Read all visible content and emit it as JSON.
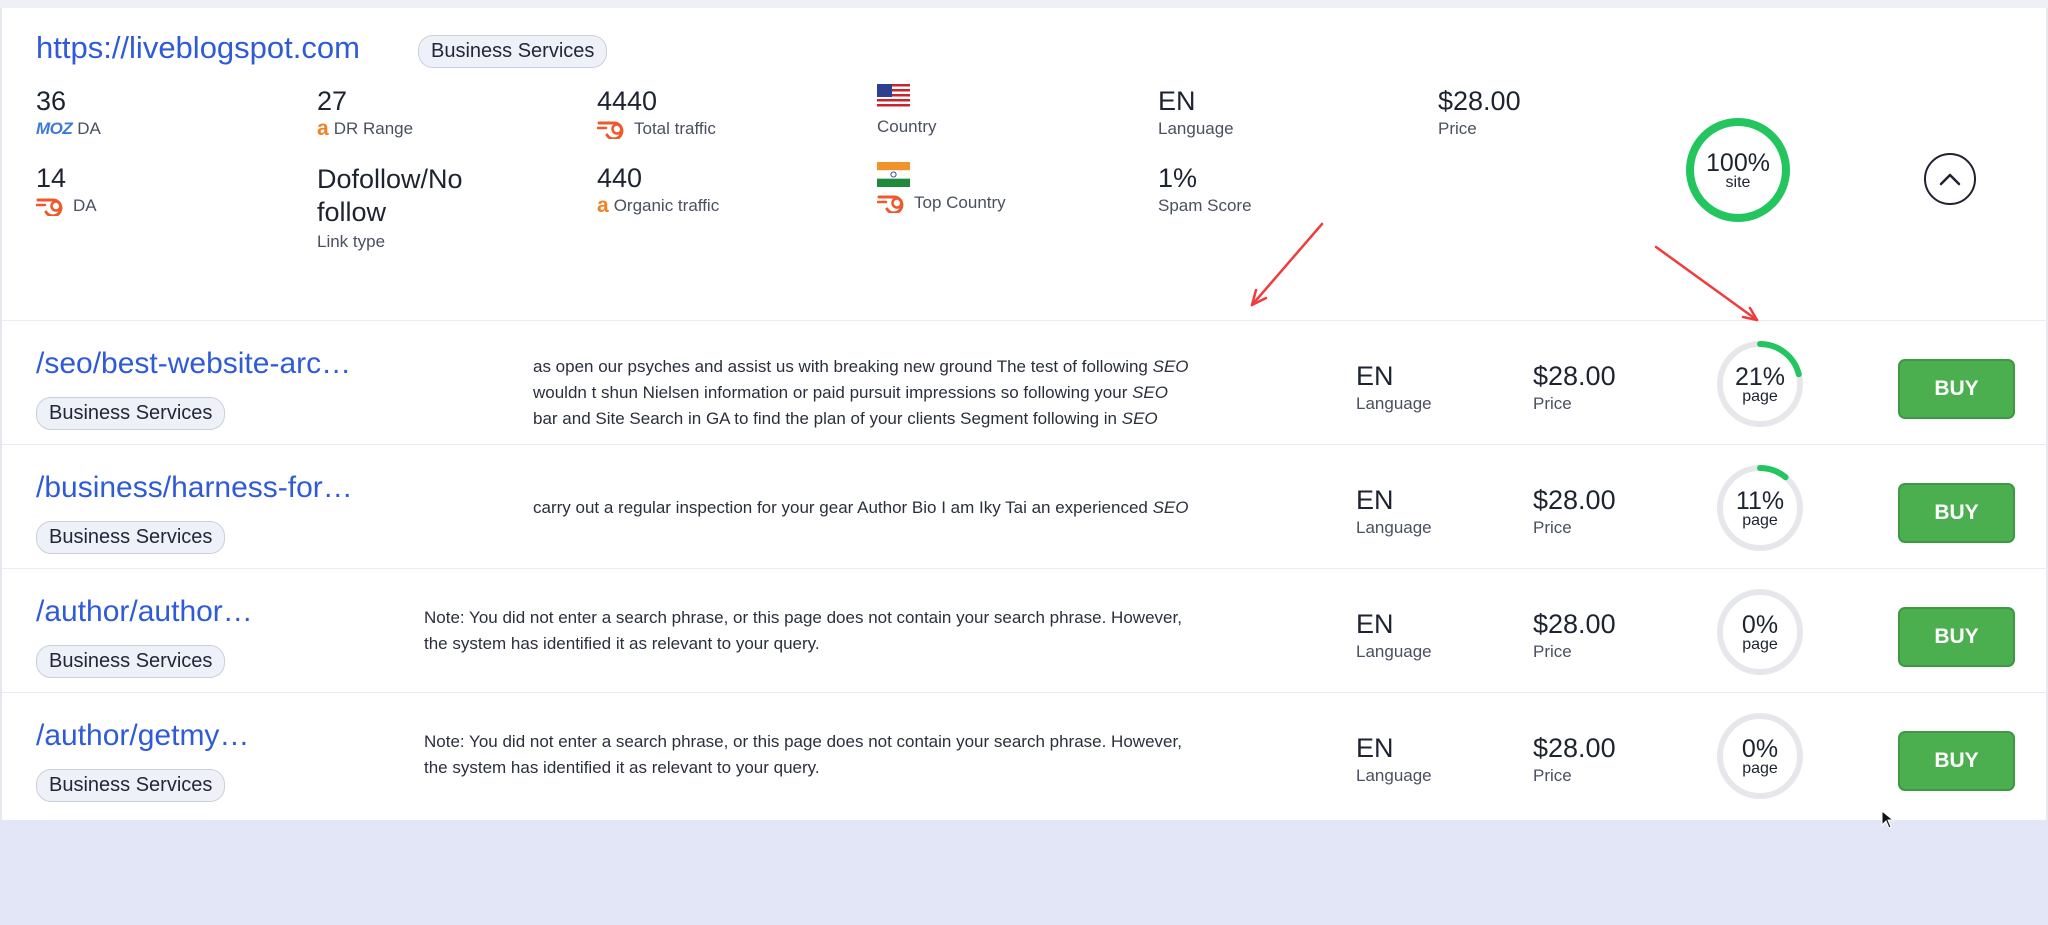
{
  "site": {
    "url": "https://liveblogspot.com",
    "category": "Business Services",
    "metrics": {
      "moz_da": {
        "value": "36",
        "brand": "MOZ",
        "label": "DA"
      },
      "dr": {
        "value": "27",
        "brand": "a",
        "label": "DR Range"
      },
      "total_traffic": {
        "value": "4440",
        "label": "Total traffic"
      },
      "country": {
        "label": "Country",
        "flag": "us-flag-icon"
      },
      "language": {
        "value": "EN",
        "label": "Language"
      },
      "price": {
        "value": "$28.00",
        "label": "Price"
      },
      "semrush_da": {
        "value": "14",
        "label": "DA"
      },
      "link_type": {
        "value": "Dofollow/No follow",
        "label": "Link type"
      },
      "organic_traffic": {
        "value": "440",
        "brand": "a",
        "label": "Organic traffic"
      },
      "top_country": {
        "label": "Top Country",
        "flag": "india-flag-icon"
      },
      "spam_score": {
        "value": "1%",
        "label": "Spam Score"
      }
    },
    "match": {
      "percent": 100,
      "text": "100%",
      "sub": "site"
    }
  },
  "colors": {
    "link": "#2f5bd8",
    "ring_green": "#22c55e",
    "ring_track": "#e5e7eb",
    "buy_green": "#4bae4f",
    "annotation_red": "#f03c3c"
  },
  "pages": [
    {
      "path": "/seo/best-website-arc…",
      "category": "Business Services",
      "snippet": [
        [
          {
            "t": "as open our psyches and assist us with breaking new ground The test of following "
          },
          {
            "t": "SEO",
            "em": true
          }
        ],
        [
          {
            "t": "wouldn t shun Nielsen information or paid pursuit impressions so following your "
          },
          {
            "t": "SEO",
            "em": true
          }
        ],
        [
          {
            "t": "bar and Site Search in GA to find the plan of your clients Segment following in "
          },
          {
            "t": "SEO",
            "em": true
          }
        ]
      ],
      "language": "EN",
      "language_label": "Language",
      "price": "$28.00",
      "price_label": "Price",
      "match": {
        "percent": 21,
        "text": "21%",
        "sub": "page"
      },
      "buy_label": "BUY"
    },
    {
      "path": "/business/harness-for…",
      "category": "Business Services",
      "snippet": [
        [
          {
            "t": "carry out a regular inspection for your gear Author Bio I am Iky Tai an experienced "
          },
          {
            "t": "SEO",
            "em": true
          }
        ]
      ],
      "language": "EN",
      "language_label": "Language",
      "price": "$28.00",
      "price_label": "Price",
      "match": {
        "percent": 11,
        "text": "11%",
        "sub": "page"
      },
      "buy_label": "BUY"
    },
    {
      "path": "/author/author…",
      "category": "Business Services",
      "snippet": [
        [
          {
            "t": "Note: You did not enter a search phrase, or this page does not contain your search phrase. However,"
          }
        ],
        [
          {
            "t": "the system has identified it as relevant to your query."
          }
        ]
      ],
      "language": "EN",
      "language_label": "Language",
      "price": "$28.00",
      "price_label": "Price",
      "match": {
        "percent": 0,
        "text": "0%",
        "sub": "page"
      },
      "buy_label": "BUY"
    },
    {
      "path": "/author/getmy…",
      "category": "Business Services",
      "snippet": [
        [
          {
            "t": "Note: You did not enter a search phrase, or this page does not contain your search phrase. However,"
          }
        ],
        [
          {
            "t": "the system has identified it as relevant to your query."
          }
        ]
      ],
      "language": "EN",
      "language_label": "Language",
      "price": "$28.00",
      "price_label": "Price",
      "match": {
        "percent": 0,
        "text": "0%",
        "sub": "page"
      },
      "buy_label": "BUY"
    }
  ]
}
